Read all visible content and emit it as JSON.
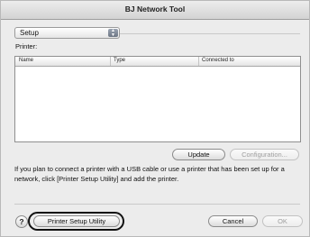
{
  "window": {
    "title": "BJ Network Tool"
  },
  "mode_popup": {
    "value": "Setup"
  },
  "printer_section": {
    "label": "Printer:"
  },
  "printer_table": {
    "columns": [
      "Name",
      "Type",
      "Connected to"
    ],
    "rows": []
  },
  "buttons": {
    "update": "Update",
    "configuration": "Configuration...",
    "printer_setup_utility": "Printer Setup Utility",
    "cancel": "Cancel",
    "ok": "OK",
    "help": "?"
  },
  "info_text": "If you plan to connect a printer with a USB cable or use a printer that has been set up for a network, click [Printer Setup Utility] and add the printer.",
  "colors": {
    "window_bg": "#ececec",
    "highlight_outline": "#111111"
  }
}
